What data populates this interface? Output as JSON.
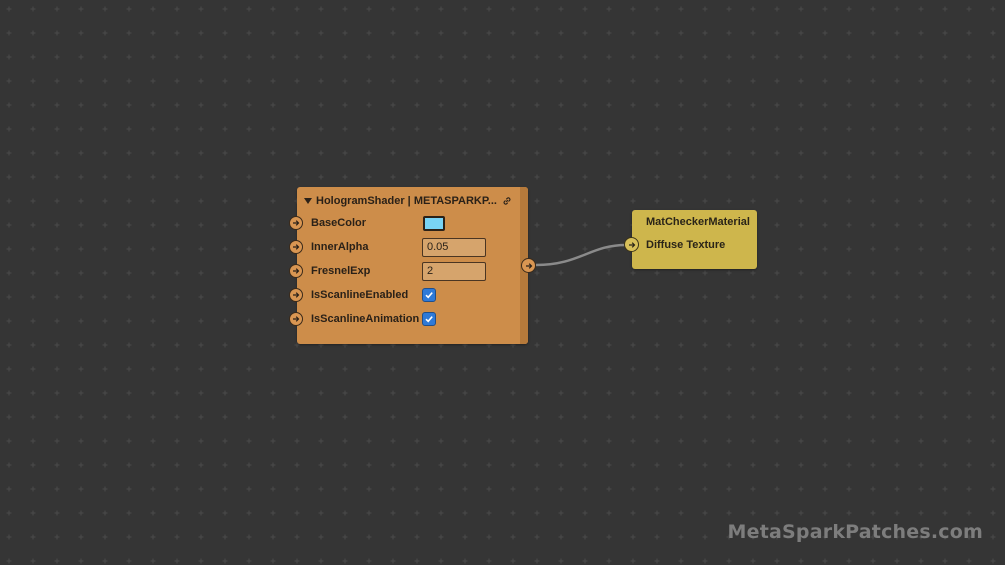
{
  "canvas": {
    "background": "#353535",
    "grid_mark_color": "#4a4a4a"
  },
  "shader_node": {
    "title": "HologramShader | METASPARKP...",
    "color": "#cd8d4a",
    "icons": [
      "collapse-triangle-icon",
      "link-icon"
    ],
    "inputs": [
      {
        "label": "BaseColor",
        "type": "color",
        "value": "#79d4f5"
      },
      {
        "label": "InnerAlpha",
        "type": "number",
        "value": "0.05"
      },
      {
        "label": "FresnelExp",
        "type": "number",
        "value": "2"
      },
      {
        "label": "IsScanlineEnabled",
        "type": "checkbox",
        "checked": true
      },
      {
        "label": "IsScanlineAnimation",
        "type": "checkbox",
        "checked": true
      }
    ]
  },
  "material_node": {
    "title": "MatCheckerMaterial",
    "color": "#ceb64c",
    "input_label": "Diffuse Texture"
  },
  "watermark": {
    "text": "MetaSparkPatches.com"
  }
}
